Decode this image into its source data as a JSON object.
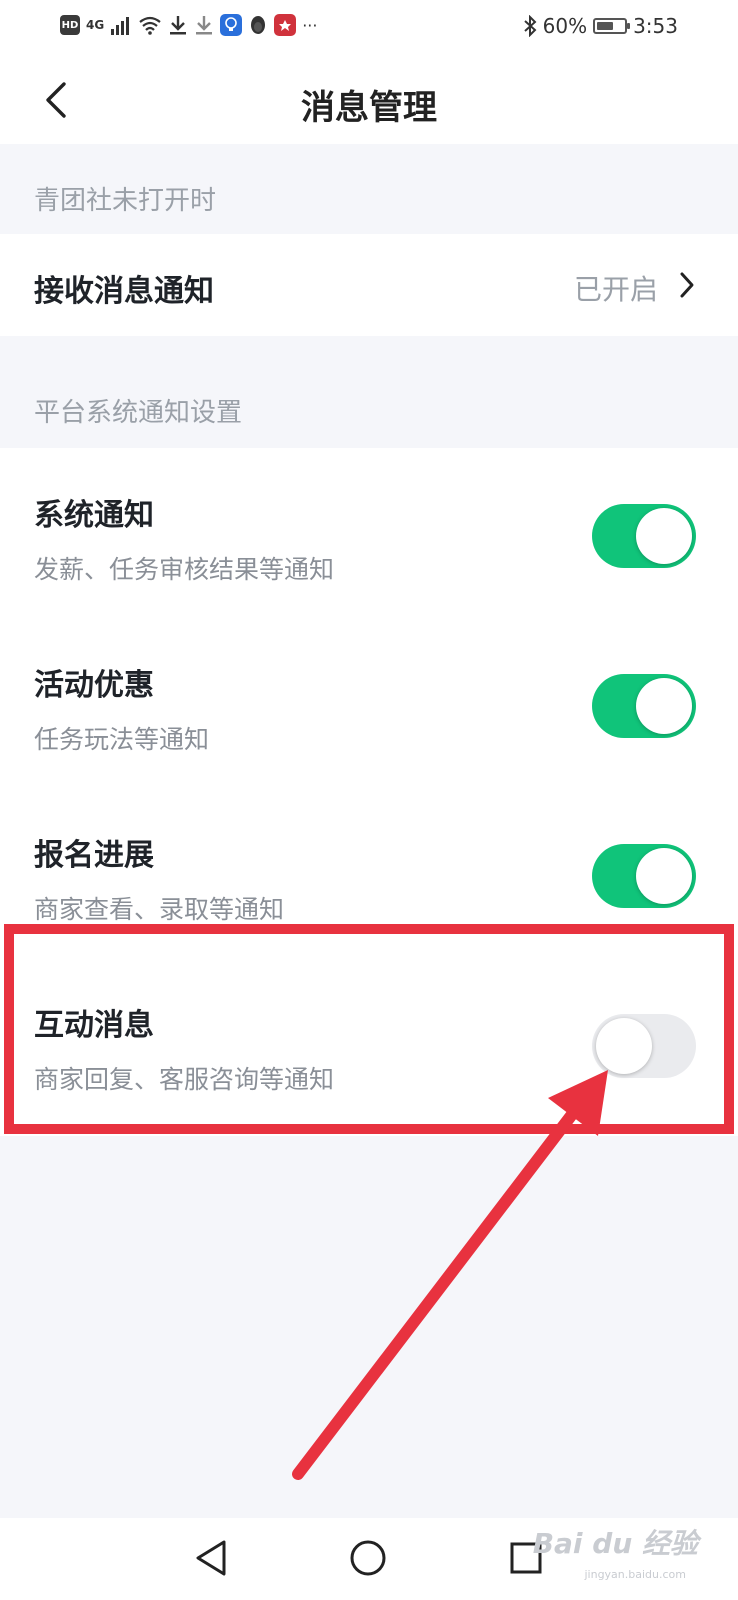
{
  "status_bar": {
    "hd": "HD",
    "network": "4G",
    "battery": "60%",
    "battery_level": 0.6,
    "time": "3:53",
    "more": "···"
  },
  "header": {
    "title": "消息管理"
  },
  "sections": {
    "closed_header": "青团社未打开时",
    "receive": {
      "title": "接收消息通知",
      "value": "已开启"
    },
    "platform_header": "平台系统通知设置",
    "items": [
      {
        "title": "系统通知",
        "sub": "发薪、任务审核结果等通知",
        "on": true
      },
      {
        "title": "活动优惠",
        "sub": "任务玩法等通知",
        "on": true
      },
      {
        "title": "报名进展",
        "sub": "商家查看、录取等通知",
        "on": true
      },
      {
        "title": "互动消息",
        "sub": "商家回复、客服咨询等通知",
        "on": false
      }
    ]
  },
  "watermark": {
    "main": "Bai du 经验",
    "sub": "jingyan.baidu.com"
  },
  "colors": {
    "toggle_on": "#10c47a",
    "toggle_off": "#eaebee",
    "highlight": "#e8323f"
  }
}
